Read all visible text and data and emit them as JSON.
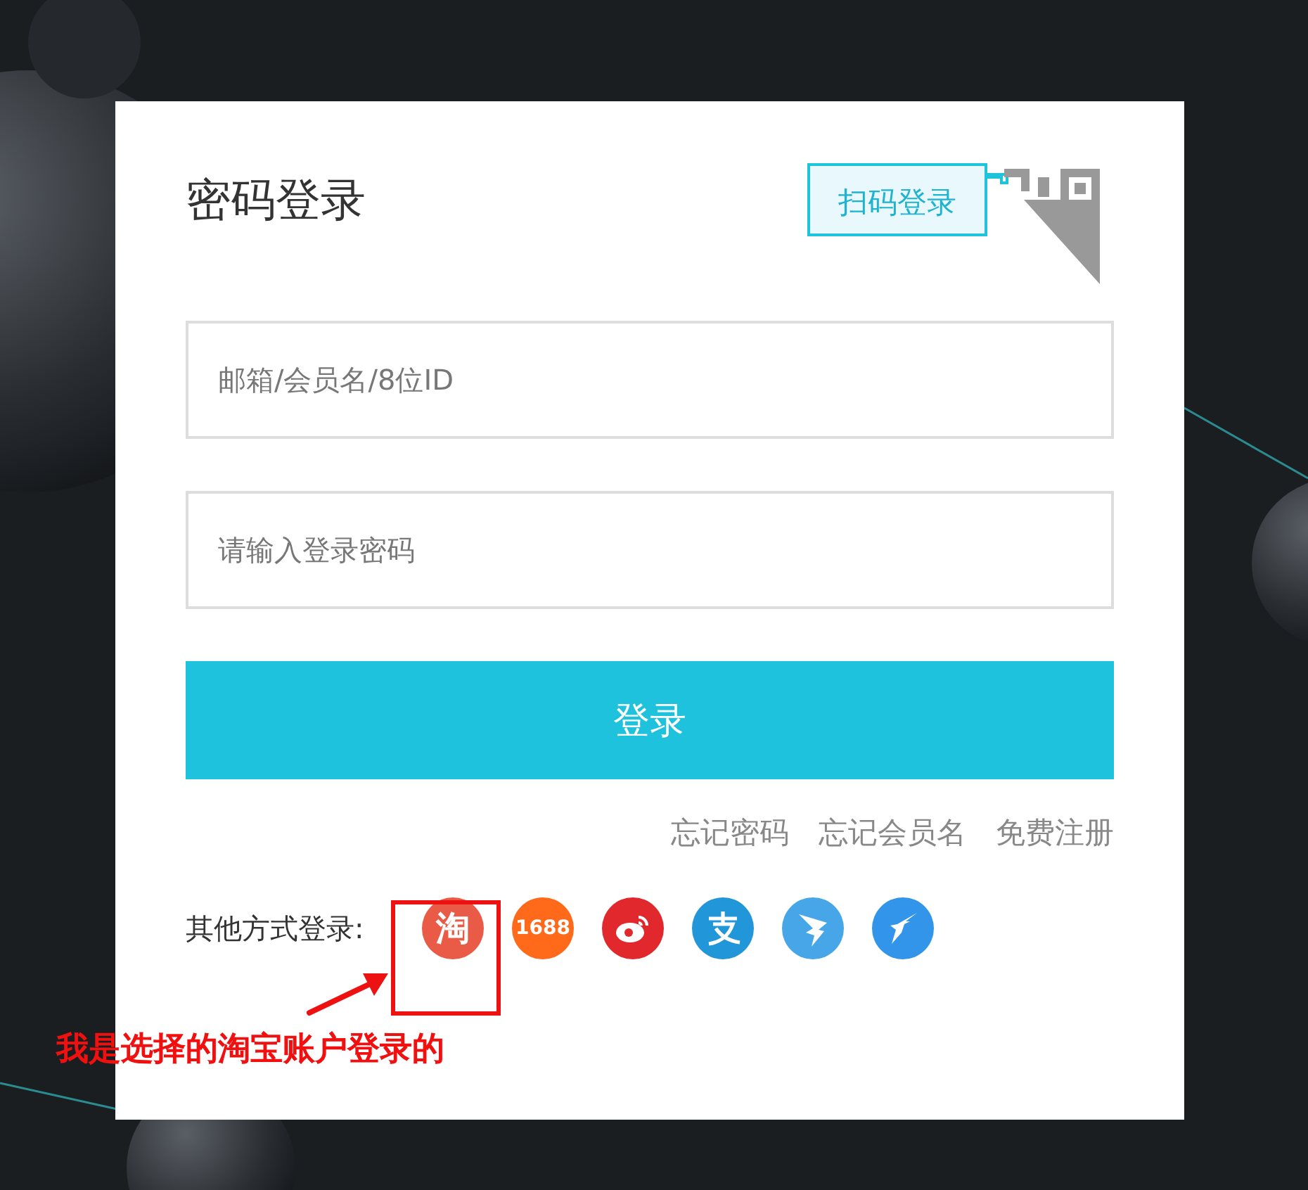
{
  "title": "密码登录",
  "qr_tab": {
    "label": "扫码登录"
  },
  "fields": [
    {
      "placeholder": "邮箱/会员名/8位ID"
    },
    {
      "placeholder": "请输入登录密码"
    }
  ],
  "login_button": "登录",
  "links": [
    "忘记密码",
    "忘记会员名",
    "免费注册"
  ],
  "other_login": {
    "label": "其他方式登录:",
    "providers": [
      {
        "kind": "text",
        "label": "淘",
        "color": "#e95b46"
      },
      {
        "kind": "text",
        "label": "1688",
        "color": "#ff6a1a"
      },
      {
        "kind": "weibo",
        "color": "#e0282d"
      },
      {
        "kind": "alipay",
        "color": "#2196d8"
      },
      {
        "kind": "dingtalk",
        "color": "#46a6e8"
      },
      {
        "kind": "bird",
        "color": "#3295ea"
      }
    ]
  },
  "annotation": {
    "text": "我是选择的淘宝账户登录的"
  }
}
